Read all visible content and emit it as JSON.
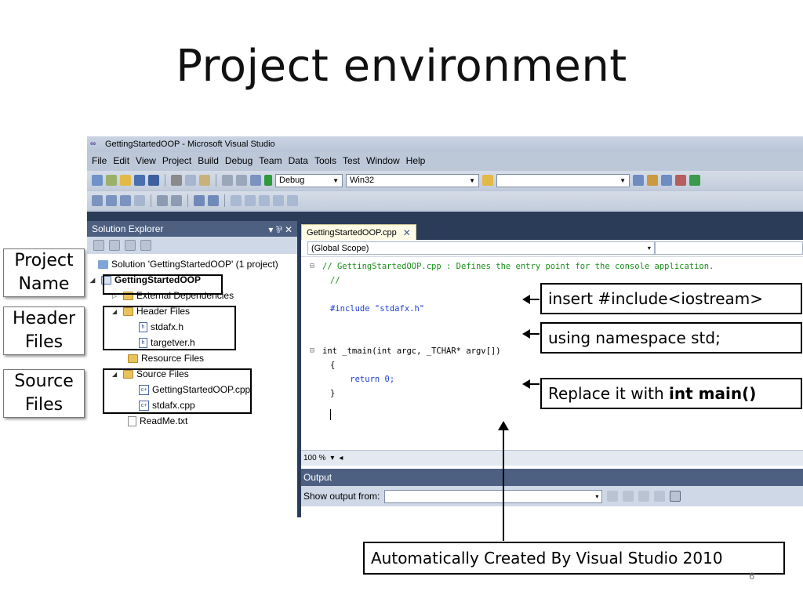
{
  "slide": {
    "title": "Project environment",
    "page_number": "6"
  },
  "window": {
    "title": "GettingStartedOOP - Microsoft Visual Studio",
    "menu": [
      "File",
      "Edit",
      "View",
      "Project",
      "Build",
      "Debug",
      "Team",
      "Data",
      "Tools",
      "Test",
      "Window",
      "Help"
    ],
    "config": "Debug",
    "platform": "Win32",
    "find_box": ""
  },
  "solution_explorer": {
    "title": "Solution Explorer",
    "pin": "▾ ⅌ ✕",
    "solution": "Solution 'GettingStartedOOP' (1 project)",
    "project": "GettingStartedOOP",
    "external": "External Dependencies",
    "header_folder": "Header Files",
    "header_files": [
      "stdafx.h",
      "targetver.h"
    ],
    "resource_folder": "Resource Files",
    "source_folder": "Source Files",
    "source_files": [
      "GettingStartedOOP.cpp",
      "stdafx.cpp"
    ],
    "readme": "ReadMe.txt"
  },
  "editor": {
    "tab": "GettingStartedOOP.cpp",
    "scope": "(Global Scope)",
    "line1": "// GettingStartedOOP.cpp : Defines the entry point for the console application.",
    "line2": "//",
    "line3": "#include \"stdafx.h\"",
    "line4": "int _tmain(int argc, _TCHAR* argv[])",
    "line5": "{",
    "line6": "    return 0;",
    "line7": "}",
    "zoom": "100 %"
  },
  "output": {
    "title": "Output",
    "show_label": "Show output from:",
    "source_value": ""
  },
  "annotations": {
    "insert": "insert #include<iostream>",
    "using": "using namespace std;",
    "replace_prefix": "Replace it with ",
    "replace_bold": "int main()",
    "auto": "Automatically Created By Visual Studio 2010",
    "project_name": "Project Name",
    "header_files": "Header Files",
    "source_files": "Source Files"
  },
  "colors": {
    "panel_header": "#4d6082",
    "dock_dark": "#2b3c59",
    "comment": "#1a8f1a",
    "keyword": "#1c3fd6",
    "string": "#a31515"
  }
}
